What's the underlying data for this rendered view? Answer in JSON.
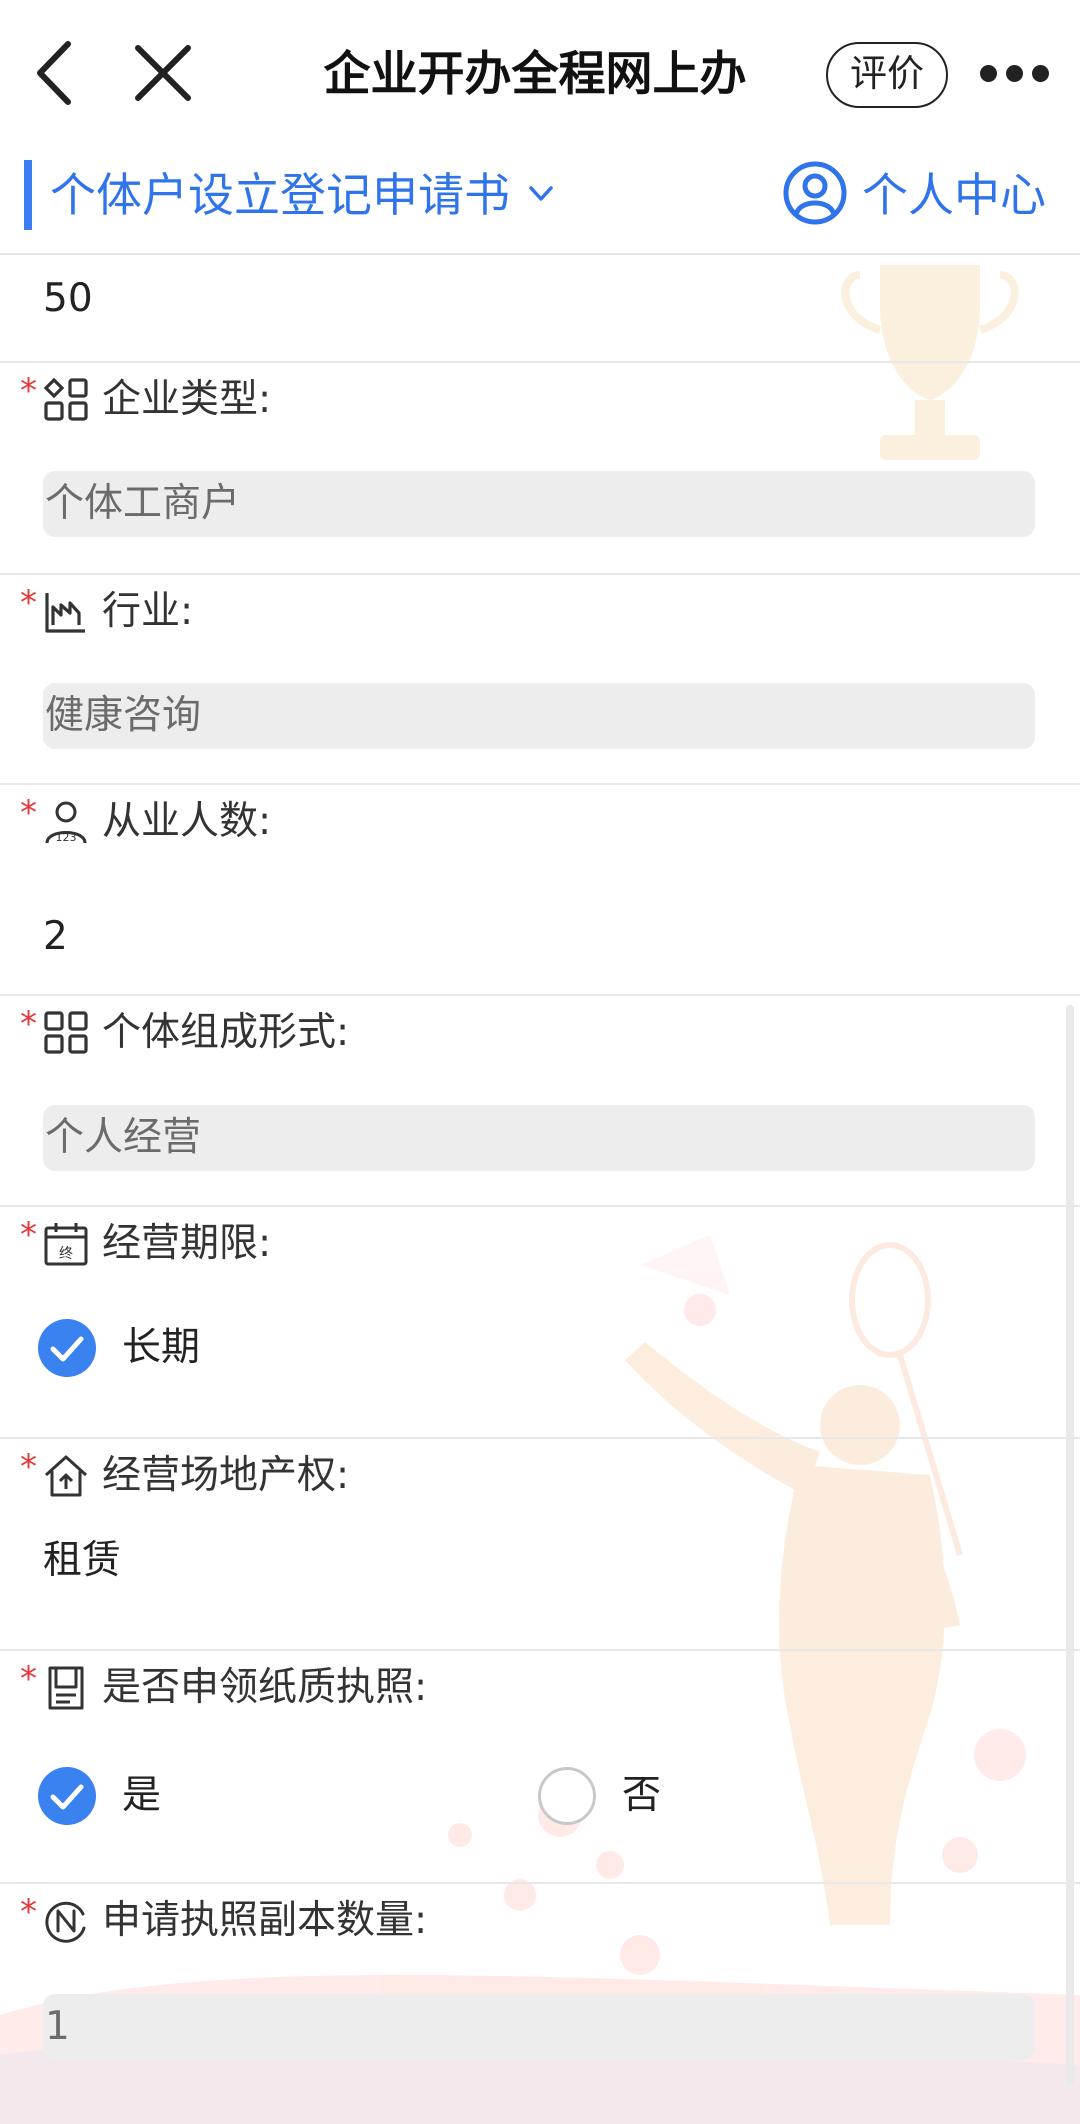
{
  "topbar": {
    "title": "企业开办全程网上办",
    "rate_label": "评价",
    "back_icon": "chevron-left-icon",
    "close_icon": "close-icon",
    "more_icon": "more-dots-icon"
  },
  "subheader": {
    "form_title": "个体户设立登记申请书",
    "user_center_label": "个人中心",
    "accent_color": "#2f74ea"
  },
  "fields": {
    "capital": {
      "value": "50"
    },
    "company_type": {
      "label": "企业类型:",
      "value": "个体工商户",
      "icon": "grid-apps-icon"
    },
    "industry": {
      "label": "行业:",
      "value": "健康咨询",
      "icon": "factory-chart-icon"
    },
    "employees": {
      "label": "从业人数:",
      "value": "2",
      "icon": "person-123-icon"
    },
    "composition": {
      "label": "个体组成形式:",
      "value": "个人经营",
      "icon": "grid-apps-icon"
    },
    "term": {
      "label": "经营期限:",
      "option": "长期",
      "checked": true,
      "icon": "calendar-end-icon"
    },
    "premises": {
      "label": "经营场地产权:",
      "value": "租赁",
      "icon": "house-up-icon"
    },
    "paper_license": {
      "label": "是否申领纸质执照:",
      "options": [
        {
          "label": "是",
          "checked": true
        },
        {
          "label": "否",
          "checked": false
        }
      ],
      "icon": "license-doc-icon"
    },
    "copies": {
      "label": "申请执照副本数量:",
      "value": "1",
      "icon": "number-n-icon"
    }
  },
  "colors": {
    "required": "#e5383b",
    "check": "#3a82f0"
  }
}
